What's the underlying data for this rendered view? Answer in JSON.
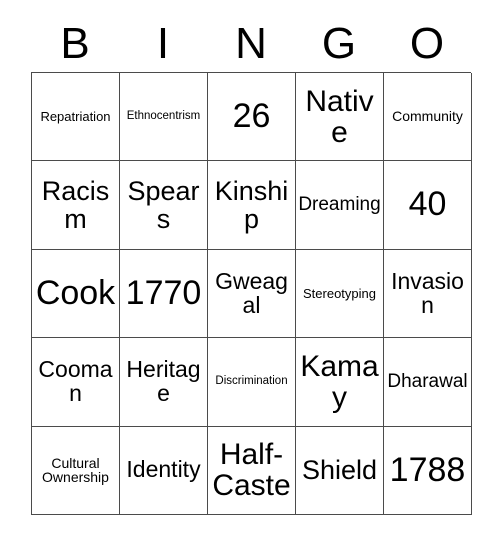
{
  "card": {
    "title": "BINGO",
    "headers": [
      "B",
      "I",
      "N",
      "G",
      "O"
    ],
    "colors": {
      "background": "#ffffff",
      "text": "#000000",
      "border": "#4b4b4b"
    },
    "rows": [
      [
        {
          "text": "Repatriation",
          "size": "sm"
        },
        {
          "text": "Ethnocentrism",
          "size": "xs"
        },
        {
          "text": "26",
          "size": "4xl"
        },
        {
          "text": "Native",
          "size": "3xl"
        },
        {
          "text": "Community",
          "size": "md"
        }
      ],
      [
        {
          "text": "Racism",
          "size": "2xl"
        },
        {
          "text": "Spears",
          "size": "2xl"
        },
        {
          "text": "Kinship",
          "size": "2xl"
        },
        {
          "text": "Dreaming",
          "size": "lg"
        },
        {
          "text": "40",
          "size": "4xl"
        }
      ],
      [
        {
          "text": "Cook",
          "size": "4xl"
        },
        {
          "text": "1770",
          "size": "4xl"
        },
        {
          "text": "Gweagal",
          "size": "xl"
        },
        {
          "text": "Stereotyping",
          "size": "sm"
        },
        {
          "text": "Invasion",
          "size": "xl"
        }
      ],
      [
        {
          "text": "Cooman",
          "size": "xl"
        },
        {
          "text": "Heritage",
          "size": "xl"
        },
        {
          "text": "Discrimination",
          "size": "xs"
        },
        {
          "text": "Kamay",
          "size": "3xl"
        },
        {
          "text": "Dharawal",
          "size": "lg"
        }
      ],
      [
        {
          "text": "Cultural Ownership",
          "size": "md"
        },
        {
          "text": "Identity",
          "size": "xl"
        },
        {
          "text": "Half-Caste",
          "size": "3xl"
        },
        {
          "text": "Shield",
          "size": "2xl"
        },
        {
          "text": "1788",
          "size": "4xl"
        }
      ]
    ]
  }
}
